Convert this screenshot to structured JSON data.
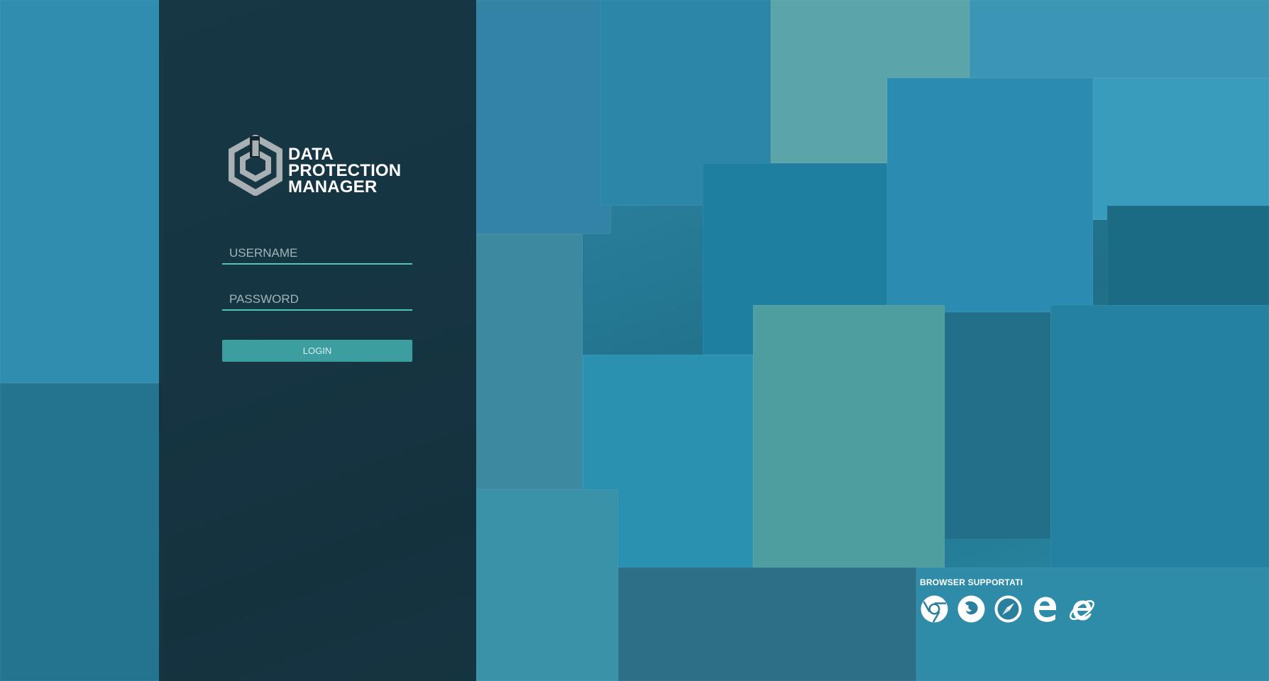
{
  "logo": {
    "lines": [
      "DATA",
      "PROTECTION",
      "MANAGER"
    ],
    "icon": "hexagon-logo-icon"
  },
  "login": {
    "username_placeholder": "USERNAME",
    "password_placeholder": "PASSWORD",
    "button_label": "LOGIN"
  },
  "browsers": {
    "title": "BROWSER SUPPORTATI",
    "icons": [
      "chrome-icon",
      "firefox-icon",
      "safari-icon",
      "edge-icon",
      "internet-explorer-icon"
    ]
  },
  "colors": {
    "accent": "#4fc4b8",
    "button": "#3d9e9f",
    "panel": "#12242e",
    "background": "#2a7f9c"
  }
}
